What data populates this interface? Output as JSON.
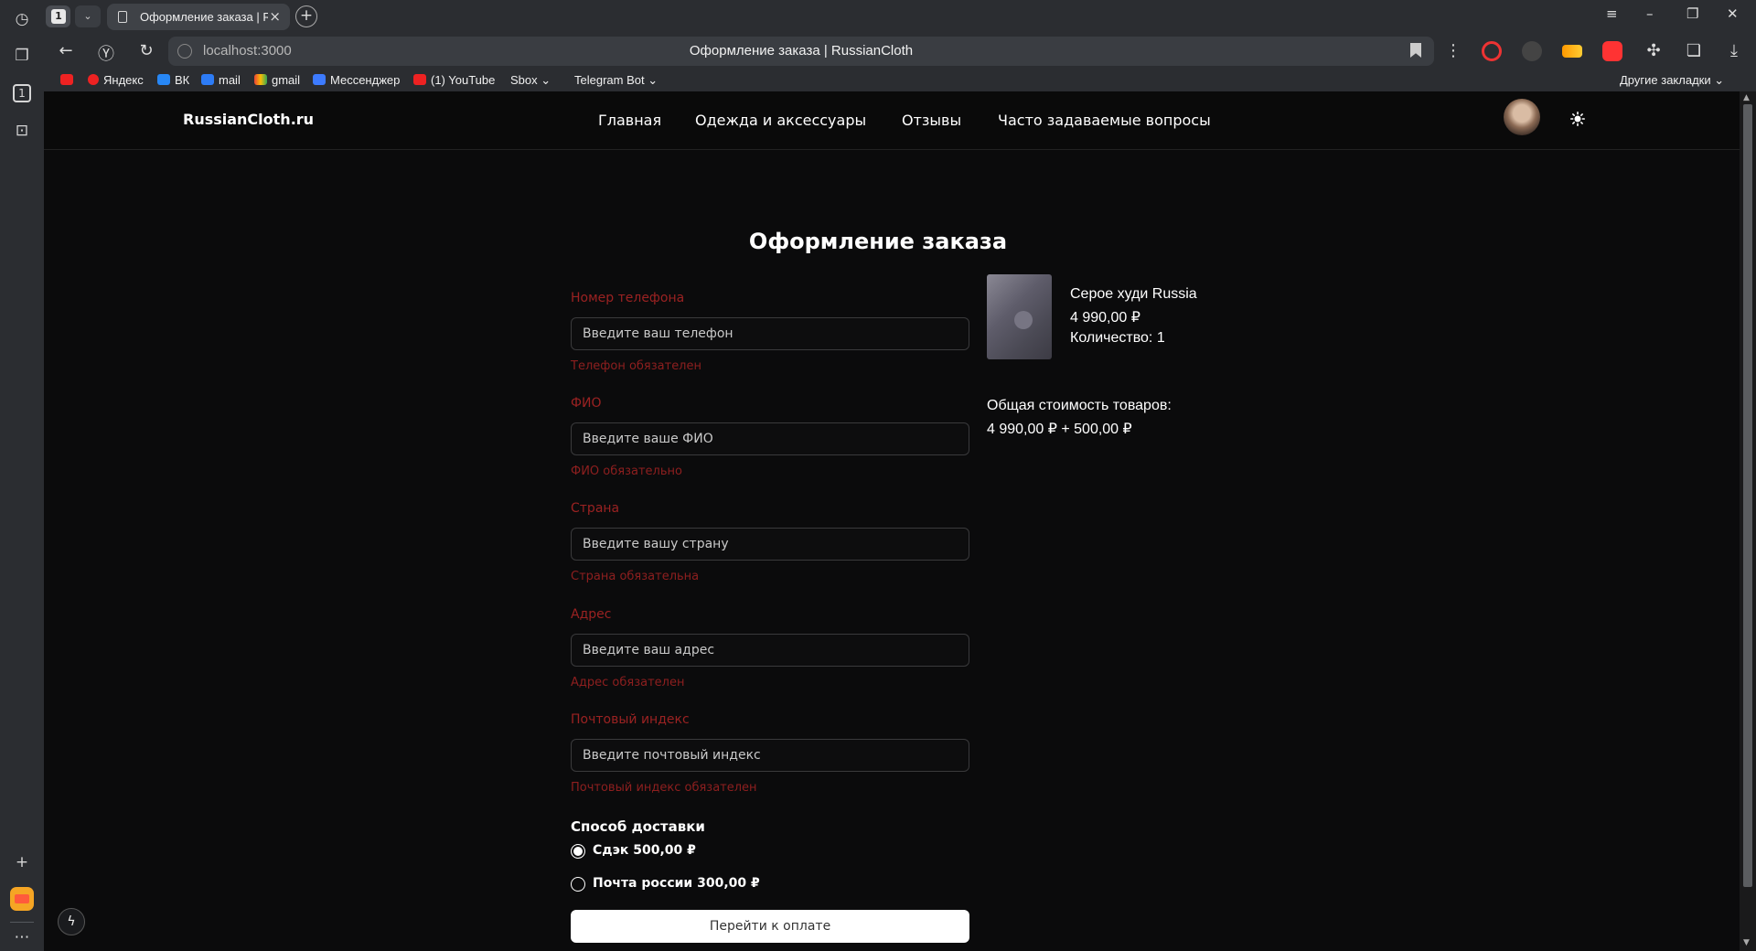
{
  "browser": {
    "tab_count": "1",
    "tab_title": "Оформление заказа | RussianCloth",
    "url": "localhost:3000",
    "page_title": "Оформление заказа | RussianCloth",
    "bookmarks": [
      "Яндекс",
      "ВК",
      "mail",
      "gmail",
      "Мессенджер",
      "(1) YouTube",
      "Sbox",
      "Telegram Bot"
    ],
    "other_bookmarks": "Другие закладки",
    "sidebar_badge": "1"
  },
  "site": {
    "logo": "RussianCloth.ru",
    "nav": [
      "Главная",
      "Одежда и аксессуары",
      "Отзывы",
      "Часто задаваемые вопросы"
    ]
  },
  "checkout": {
    "title": "Оформление заказа",
    "fields": [
      {
        "label": "Номер телефона",
        "placeholder": "Введите ваш телефон",
        "error": "Телефон обязателен"
      },
      {
        "label": "ФИО",
        "placeholder": "Введите ваше ФИО",
        "error": "ФИО обязательно"
      },
      {
        "label": "Страна",
        "placeholder": "Введите вашу страну",
        "error": "Страна обязательна"
      },
      {
        "label": "Адрес",
        "placeholder": "Введите ваш адрес",
        "error": "Адрес обязателен"
      },
      {
        "label": "Почтовый индекс",
        "placeholder": "Введите почтовый индекс",
        "error": "Почтовый индекс обязателен"
      }
    ],
    "delivery_label": "Способ доставки",
    "delivery_options": [
      {
        "label": "Сдэк 500,00 ₽",
        "selected": true
      },
      {
        "label": "Почта россии 300,00 ₽",
        "selected": false
      }
    ],
    "pay_button": "Перейти к оплате"
  },
  "order": {
    "product_name": "Серое худи Russia",
    "product_price": "4 990,00 ₽",
    "product_qty": "Количество: 1",
    "total_label": "Общая стоимость товаров:",
    "total_value": "4 990,00 ₽ + 500,00 ₽"
  },
  "colors": {
    "accent_error": "#9b2222",
    "background": "#0b0b0c"
  }
}
